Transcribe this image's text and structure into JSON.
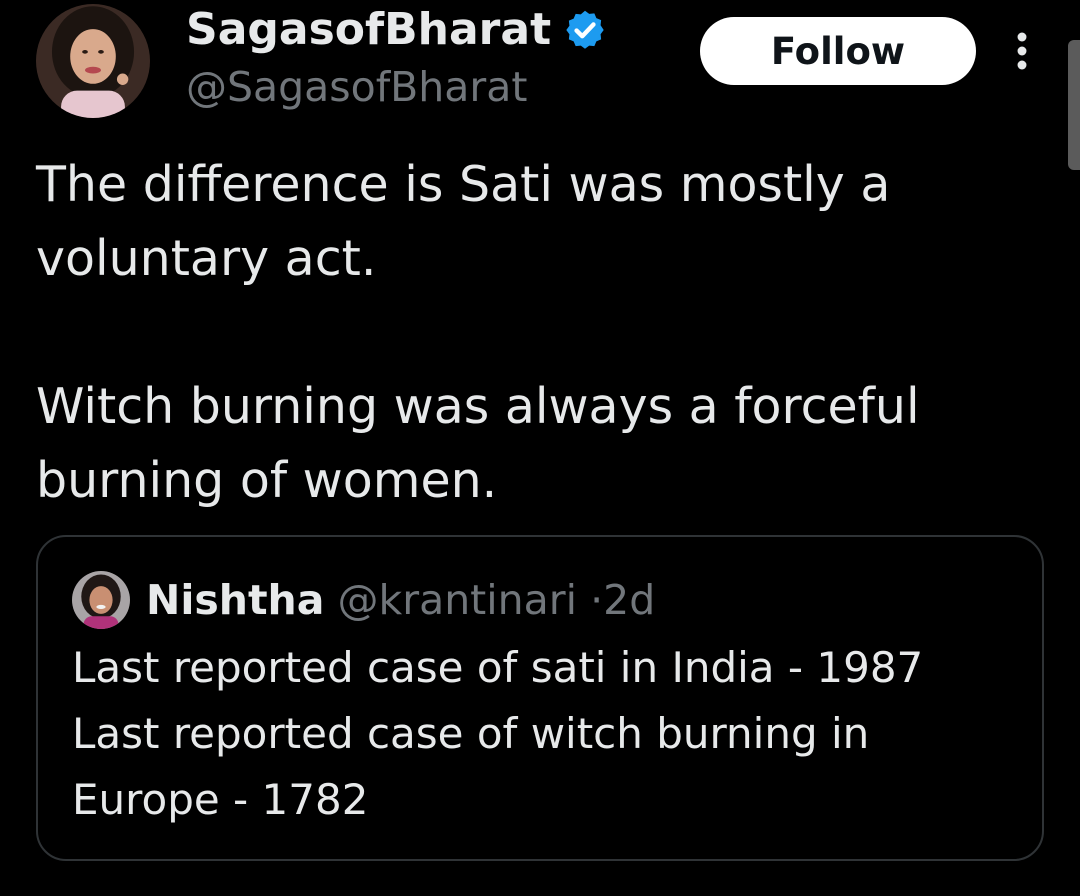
{
  "author": {
    "display_name": "SagasofBharat",
    "handle": "@SagasofBharat",
    "verified_icon": "verified-badge-icon",
    "avatar_icon": "avatar-photo"
  },
  "actions": {
    "follow_label": "Follow",
    "more_icon": "more-vertical-icon"
  },
  "tweet": {
    "paragraphs": [
      "The difference is Sati was mostly a voluntary act.",
      "Witch burning was always a forceful burning of women."
    ]
  },
  "quoted_tweet": {
    "display_name": "Nishtha",
    "handle": "@krantinari",
    "separator": "·",
    "age": "2d",
    "lines": [
      "Last reported case of sati in India - 1987",
      "Last reported case of witch burning in Europe - 1782"
    ]
  },
  "colors": {
    "background": "#000000",
    "text_primary": "#e7e9ea",
    "text_secondary": "#71767b",
    "verified_blue": "#1d9bf0",
    "border": "#2f3336",
    "follow_button_bg": "#ffffff"
  }
}
